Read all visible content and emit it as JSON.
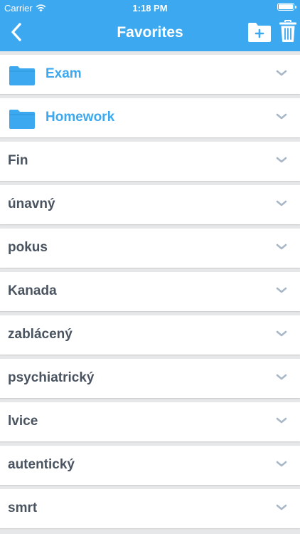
{
  "status_bar": {
    "carrier": "Carrier",
    "time": "1:18 PM"
  },
  "nav": {
    "title": "Favorites",
    "back_icon": "chevron-left-icon",
    "add_folder_icon": "folder-plus-icon",
    "trash_icon": "trash-icon"
  },
  "colors": {
    "accent": "#3ba8ef",
    "text": "#4a5460",
    "chevron": "#a9b8c8",
    "background": "#e6e7e8"
  },
  "folders": [
    {
      "label": "Exam",
      "icon": "folder-icon"
    },
    {
      "label": "Homework",
      "icon": "folder-icon"
    }
  ],
  "words": [
    {
      "label": "Fin"
    },
    {
      "label": "únavný"
    },
    {
      "label": "pokus"
    },
    {
      "label": "Kanada"
    },
    {
      "label": "zablácený"
    },
    {
      "label": "psychiatrický"
    },
    {
      "label": "lvice"
    },
    {
      "label": "autentický"
    },
    {
      "label": "smrt"
    }
  ]
}
